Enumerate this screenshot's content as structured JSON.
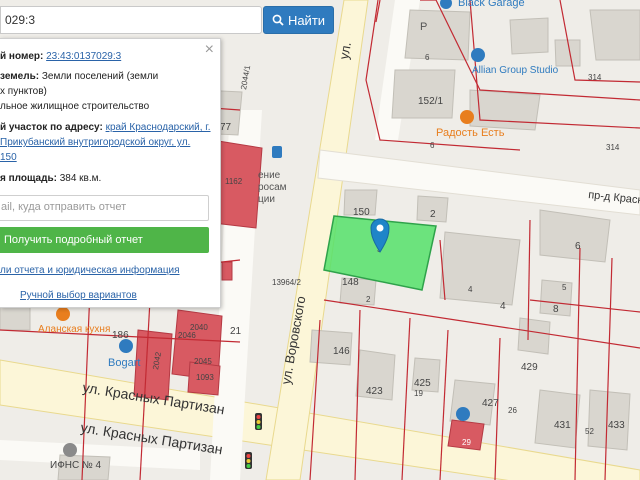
{
  "search": {
    "value": "029:3",
    "button_label": "Найти"
  },
  "panel": {
    "cadastral_label": "й номер:",
    "cadastral_value": "23:43:0137029:3",
    "land_category_label": "земель:",
    "land_category_value": "Земли поселений (земли",
    "land_category_value2": "х пунктов)",
    "usage_value": "льное жилищное строительство",
    "address_label": "й участок по адресу:",
    "address_line1": "край Краснодарский, г.",
    "address_line2": "Прикубанский внутригородской округ, ул.",
    "address_line3": "150",
    "area_label": "я площадь:",
    "area_value": "384 кв.м.",
    "email_placeholder": "ail, куда отправить отчет",
    "get_report_label": "Получить подробный отчет",
    "reports_link": "ли отчета и юридическая информация",
    "manual_link": "Ручной выбор вариантов"
  },
  "map": {
    "streets": [
      "ул. Воровского",
      "ул.",
      "ул. Красных Партизан",
      "ул. Красных Партизан",
      "пр-д Красн"
    ],
    "pois": [
      "Black Garage",
      "Allian Group Studio",
      "Радость Есть",
      "Аланская кухня",
      "Bogart",
      "ИФНС № 4"
    ],
    "house_numbers": [
      "152/1",
      "150",
      "2",
      "148",
      "2",
      "146",
      "423",
      "425",
      "427",
      "429",
      "431",
      "433",
      "4",
      "4",
      "5",
      "6",
      "8",
      "26",
      "29",
      "52",
      "13964/2",
      "2044/1",
      "2046",
      "2045",
      "2042",
      "1093",
      "1162",
      "186",
      "21",
      "77",
      "314",
      "314",
      "6",
      "6",
      "19",
      "2040"
    ],
    "misc_labels": [
      "ение",
      "росам",
      "ции",
      "P",
      "3"
    ],
    "colors": {
      "selected_parcel": "#55e06a",
      "parcel_border": "#c22a33",
      "marker": "#1f85c8",
      "red_building": "#d8555e",
      "road": "#ffffff"
    }
  }
}
